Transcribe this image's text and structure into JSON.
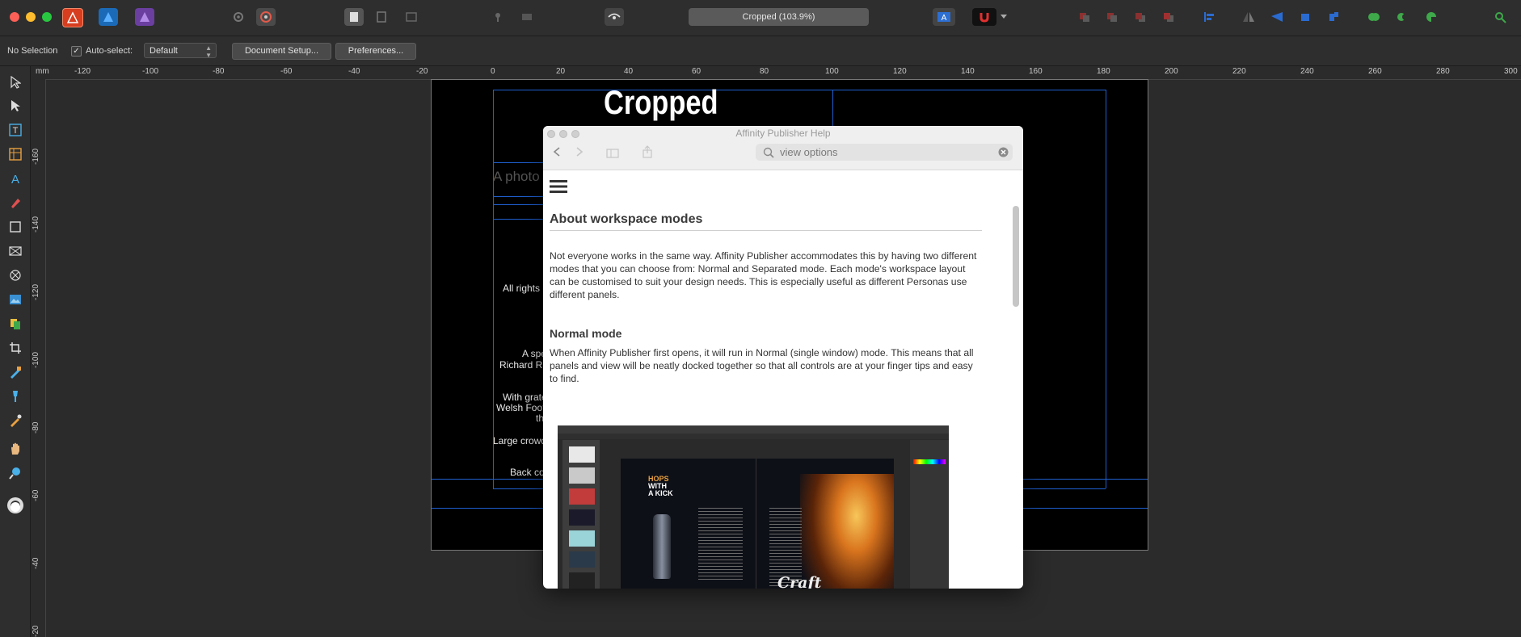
{
  "toolbar": {
    "title_pill": "Cropped (103.9%)",
    "icons": [
      "publisher-persona-icon",
      "designer-persona-icon",
      "photo-persona-icon",
      "settings-icon",
      "preferences-icon",
      "normal-view-icon",
      "bleed-view-icon",
      "preview-view-icon",
      "pin-icon",
      "flip-icon",
      "vision-icon",
      "text-frame-icon",
      "snapping-icon",
      "arrange-icons",
      "align-icons",
      "boolean-icons"
    ]
  },
  "context_bar": {
    "selection": "No Selection",
    "autoselect_label": "Auto-select:",
    "autoselect_checked": "✓",
    "autoselect_value": "Default",
    "document_setup_label": "Document Setup...",
    "preferences_label": "Preferences..."
  },
  "ruler": {
    "unit": "mm",
    "h_labels": [
      "-120",
      "-100",
      "-80",
      "-60",
      "-40",
      "-20",
      "0",
      "20",
      "40",
      "60",
      "80",
      "100",
      "120",
      "140",
      "160",
      "180",
      "200",
      "220",
      "240",
      "260",
      "280",
      "300"
    ],
    "v_labels": [
      "-160",
      "-140",
      "-120",
      "-100",
      "-80",
      "-60",
      "-40",
      "-20"
    ]
  },
  "document": {
    "heading": "Cropped",
    "photo_caption": "A photo",
    "rights": "All rights r",
    "special_1": "A spe",
    "special_2": "Richard Ru",
    "gratitude_1": "With grate",
    "gratitude_2": "Welsh Footb",
    "gratitude_3": "th",
    "crowds": "Large crowds",
    "back_cover": "Back cov"
  },
  "help": {
    "window_title": "Affinity Publisher Help",
    "search_value": "view options",
    "heading": "About workspace modes",
    "intro": "Not everyone works in the same way. Affinity Publisher accommodates this by having two different modes that you can choose from: Normal and Separated mode. Each mode's workspace layout can be customised to suit your design needs. This is especially useful as different Personas use different panels.",
    "normal_heading": "Normal mode",
    "normal_text": "When Affinity Publisher first opens, it will run in Normal (single window) mode. This means that all panels and view will be neatly docked together so that all controls are at your finger tips and easy to find.",
    "image": {
      "headline_1": "HOPS",
      "headline_2": "WITH",
      "headline_3": "A KICK",
      "brand": "Craft"
    }
  },
  "colors": {
    "accent_guides": "#1f5fd0",
    "app_bg": "#2b2b2b",
    "help_bg": "#ffffff"
  }
}
